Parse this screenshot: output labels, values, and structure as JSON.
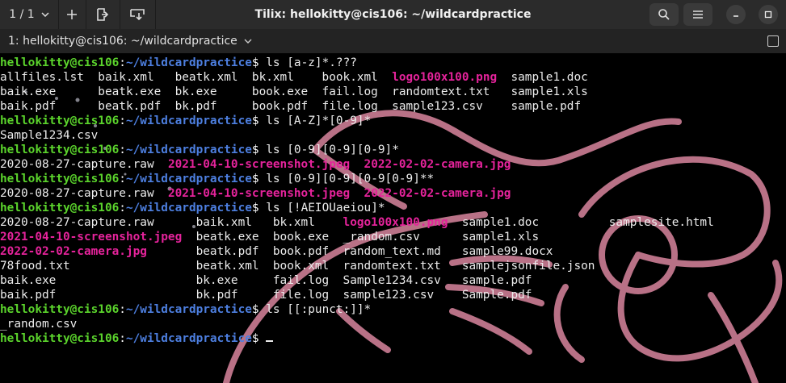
{
  "titlebar": {
    "session_label": "1 / 1",
    "title": "Tilix: hellokitty@cis106: ~/wildcardpractice",
    "icons": [
      "chevron-down-icon",
      "plus-icon",
      "split-right-icon",
      "split-down-icon",
      "search-icon",
      "hamburger-menu-icon",
      "minimize-icon",
      "maximize-icon"
    ]
  },
  "terminal_header": {
    "title": "1: hellokitty@cis106: ~/wildcardpractice"
  },
  "colors": {
    "prompt_user": "#5bd42c",
    "prompt_path": "#4d7fe0",
    "image_file": "#e5239b",
    "text": "#ececec",
    "background": "#000000"
  },
  "prompt": {
    "user": "hellokitty@cis106",
    "path": "~/wildcardpractice",
    "dollar": "$"
  },
  "terminal": {
    "lines": [
      {
        "type": "cmd",
        "text": "ls [a-z]*.???"
      },
      {
        "type": "out",
        "segs": [
          {
            "t": "allfiles.lst  baik.xml   beatk.xml  bk.xml    book.xml  "
          },
          {
            "t": "logo100x100.png",
            "c": "img"
          },
          {
            "t": "  sample1.doc"
          }
        ]
      },
      {
        "type": "out",
        "segs": [
          {
            "t": "baik.exe      beatk.exe  bk.exe     book.exe  fail.log  randomtext.txt   sample1.xls"
          }
        ]
      },
      {
        "type": "out",
        "segs": [
          {
            "t": "baik.pdf      beatk.pdf  bk.pdf     book.pdf  file.log  sample123.csv    sample.pdf"
          }
        ]
      },
      {
        "type": "cmd",
        "text": "ls [A-Z]*[0-9]*"
      },
      {
        "type": "out",
        "segs": [
          {
            "t": "Sample1234.csv"
          }
        ]
      },
      {
        "type": "cmd",
        "text": "ls [0-9][0-9][0-9]*"
      },
      {
        "type": "out",
        "segs": [
          {
            "t": "2020-08-27-capture.raw  "
          },
          {
            "t": "2021-04-10-screenshot.jpeg",
            "c": "img"
          },
          {
            "t": "  "
          },
          {
            "t": "2022-02-02-camera.jpg",
            "c": "img"
          }
        ]
      },
      {
        "type": "cmd",
        "text": "ls [0-9][0-9][0-9[0-9]**"
      },
      {
        "type": "out",
        "segs": [
          {
            "t": "2020-08-27-capture.raw  "
          },
          {
            "t": "2021-04-10-screenshot.jpeg",
            "c": "img"
          },
          {
            "t": "  "
          },
          {
            "t": "2022-02-02-camera.jpg",
            "c": "img"
          }
        ]
      },
      {
        "type": "cmd",
        "text": "ls [!AEIOUaeiou]*"
      },
      {
        "type": "out",
        "segs": [
          {
            "t": "2020-08-27-capture.raw      baik.xml   bk.xml    "
          },
          {
            "t": "logo100x100.png",
            "c": "img"
          },
          {
            "t": "  sample1.doc          samplesite.html"
          }
        ]
      },
      {
        "type": "out",
        "segs": [
          {
            "t": "2021-04-10-screenshot.jpeg",
            "c": "img"
          },
          {
            "t": "  beatk.exe  book.exe  _random.csv      sample1.xls"
          }
        ]
      },
      {
        "type": "out",
        "segs": [
          {
            "t": "2022-02-02-camera.jpg",
            "c": "img"
          },
          {
            "t": "       beatk.pdf  book.pdf  random_text.md   sample99.docx"
          }
        ]
      },
      {
        "type": "out",
        "segs": [
          {
            "t": "78food.txt                  beatk.xml  book.xml  randomtext.txt   samplejsonfile.json"
          }
        ]
      },
      {
        "type": "out",
        "segs": [
          {
            "t": "baik.exe                    bk.exe     fail.log  Sample1234.csv   sample.pdf"
          }
        ]
      },
      {
        "type": "out",
        "segs": [
          {
            "t": "baik.pdf                    bk.pdf     file.log  sample123.csv    Sample.pdf"
          }
        ]
      },
      {
        "type": "cmd",
        "text": "ls [[:punct:]]*"
      },
      {
        "type": "out",
        "segs": [
          {
            "t": "_random.csv"
          }
        ]
      },
      {
        "type": "cmd",
        "text": "",
        "cursor": true
      }
    ]
  }
}
